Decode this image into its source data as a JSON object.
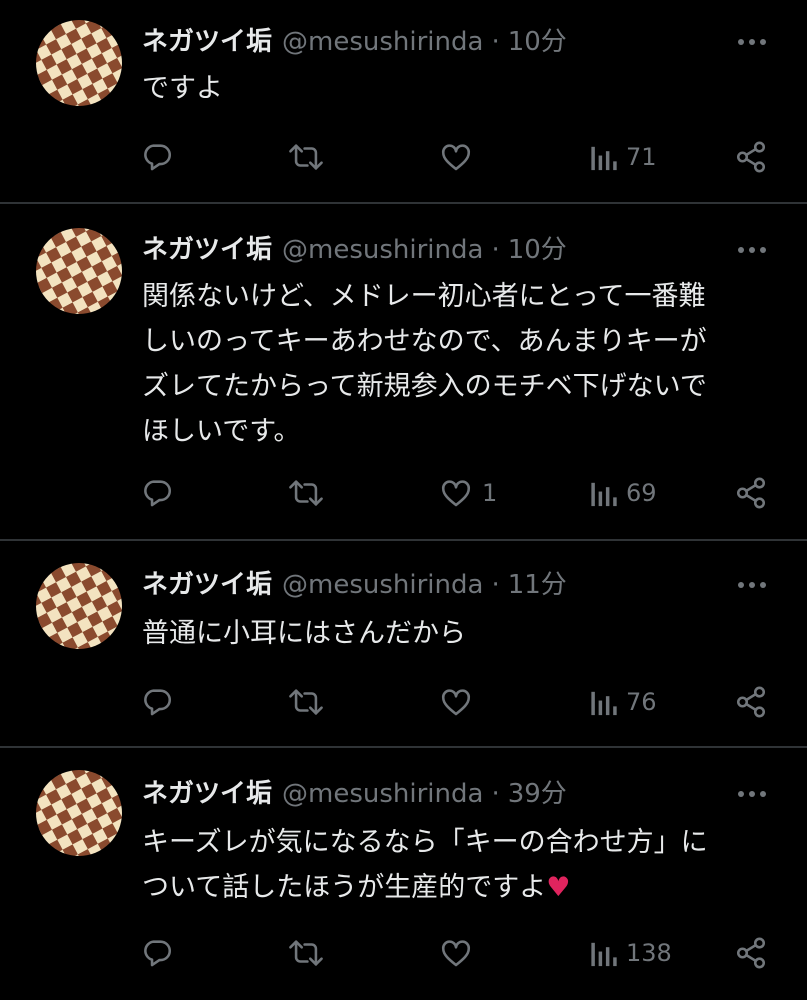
{
  "tweets": [
    {
      "name": "ネガツイ垢",
      "handle": "@mesushirinda",
      "dot": "·",
      "time": "10分",
      "text": "ですよ",
      "heart_emoji": "",
      "likes": "",
      "views": "71"
    },
    {
      "name": "ネガツイ垢",
      "handle": "@mesushirinda",
      "dot": "·",
      "time": "10分",
      "text": "関係ないけど、メドレー初心者にとって一番難\nしいのってキーあわせなので、あんまりキーが\nズレてたからって新規参入のモチベ下げないで\nほしいです。",
      "heart_emoji": "",
      "likes": "1",
      "views": "69"
    },
    {
      "name": "ネガツイ垢",
      "handle": "@mesushirinda",
      "dot": "·",
      "time": "11分",
      "text": "普通に小耳にはさんだから",
      "heart_emoji": "",
      "likes": "",
      "views": "76"
    },
    {
      "name": "ネガツイ垢",
      "handle": "@mesushirinda",
      "dot": "·",
      "time": "39分",
      "text": "キーズレが気になるなら「キーの合わせ方」に\nついて話したほうが生産的ですよ",
      "heart_emoji": "♥",
      "likes": "",
      "views": "138"
    }
  ],
  "colors": {
    "background": "#000000",
    "text": "#e7e9ea",
    "muted": "#71767b",
    "divider": "#2f3336",
    "heart": "#e0245e",
    "avatar_light": "#f3e3c0",
    "avatar_dark": "#8a4a2e"
  },
  "icons": [
    "more-icon",
    "reply-icon",
    "retweet-icon",
    "like-icon",
    "views-icon",
    "share-icon"
  ]
}
